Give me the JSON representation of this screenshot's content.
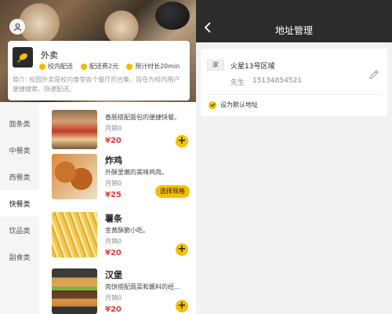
{
  "shop": {
    "name": "外卖",
    "tags": [
      "校内配送",
      "配送费2元",
      "预计时长20min"
    ],
    "description": "简介: 校园外卖是校内食堂各个餐厅的合集，旨在为校内用户便捷搜索、快速配送。"
  },
  "categories": [
    "面条类",
    "中餐类",
    "西餐类",
    "快餐类",
    "饮品类",
    "副食类"
  ],
  "active_category_index": 3,
  "foods": [
    {
      "name": "",
      "desc": "香肠搭配面包的便捷快餐。",
      "sales": "月销0",
      "price": "¥20",
      "action": "add",
      "image": "hotdog"
    },
    {
      "name": "炸鸡",
      "desc": "外酥里嫩的美味鸡肉。",
      "sales": "月销0",
      "price": "¥25",
      "action": "选择规格",
      "image": "fried-chicken"
    },
    {
      "name": "薯条",
      "desc": "金黄酥脆小吃。",
      "sales": "月销0",
      "price": "¥20",
      "action": "add",
      "image": "fries"
    },
    {
      "name": "汉堡",
      "desc": "肉饼搭配蔬菜和酱料的经...",
      "sales": "月销0",
      "price": "¥20",
      "action": "add",
      "image": "burger"
    }
  ],
  "add_symbol": "+",
  "address_page": {
    "title": "地址管理",
    "tag": "家",
    "address": "火星13号区域",
    "person": "先生",
    "phone": "15134854521",
    "default_label": "设为默认地址"
  },
  "colors": {
    "accent": "#f5c000",
    "price": "#e53935",
    "nav_bg": "#2c2c2c"
  },
  "icons": [
    "user-icon",
    "shop-logo-icon",
    "back-icon",
    "edit-icon",
    "check-icon"
  ]
}
